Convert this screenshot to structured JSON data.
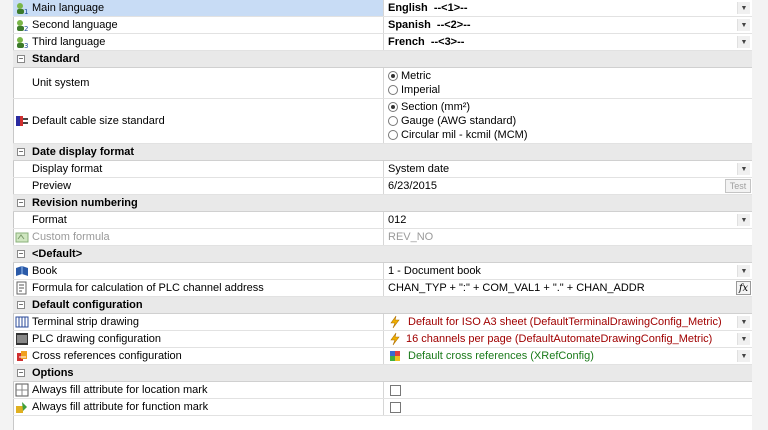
{
  "languages": {
    "main": {
      "label": "Main language",
      "value": "English",
      "tag": "--<1>--"
    },
    "second": {
      "label": "Second language",
      "value": "Spanish",
      "tag": "--<2>--"
    },
    "third": {
      "label": "Third language",
      "value": "French",
      "tag": "--<3>--"
    }
  },
  "standard": {
    "title": "Standard",
    "unit_label": "Unit system",
    "unit_options": [
      "Metric",
      "Imperial"
    ],
    "unit_selected": "Metric",
    "cable_label": "Default cable size standard",
    "cable_options": [
      "Section (mm²)",
      "Gauge (AWG standard)",
      "Circular mil - kcmil (MCM)"
    ],
    "cable_selected": "Section (mm²)"
  },
  "date": {
    "title": "Date display format",
    "display_label": "Display format",
    "display_value": "System date",
    "preview_label": "Preview",
    "preview_value": "6/23/2015",
    "test_label": "Test"
  },
  "revision": {
    "title": "Revision numbering",
    "format_label": "Format",
    "format_value": "012",
    "custom_label": "Custom formula",
    "custom_value": "REV_NO"
  },
  "default": {
    "title": "<Default>",
    "book_label": "Book",
    "book_value": "1 - Document book",
    "plc_label": "Formula for calculation of PLC channel address",
    "plc_value": "CHAN_TYP + \":\" + COM_VAL1 + \".\" + CHAN_ADDR",
    "fx_label": "fx"
  },
  "config": {
    "title": "Default configuration",
    "terminal_label": "Terminal strip drawing",
    "terminal_value": "Default for ISO A3 sheet (DefaultTerminalDrawingConfig_Metric)",
    "plc_label": "PLC drawing configuration",
    "plc_value": "16 channels per page (DefaultAutomateDrawingConfig_Metric)",
    "xref_label": "Cross references configuration",
    "xref_value": "Default cross references (XRefConfig)"
  },
  "options": {
    "title": "Options",
    "location_label": "Always fill attribute for location mark",
    "function_label": "Always fill attribute for function mark",
    "location_checked": false,
    "function_checked": false
  },
  "colors": {
    "selected_row": "#c8dcf5",
    "category_bg": "#e9e9e9",
    "red_text": "#a00000",
    "green_text": "#1a7a1a"
  }
}
